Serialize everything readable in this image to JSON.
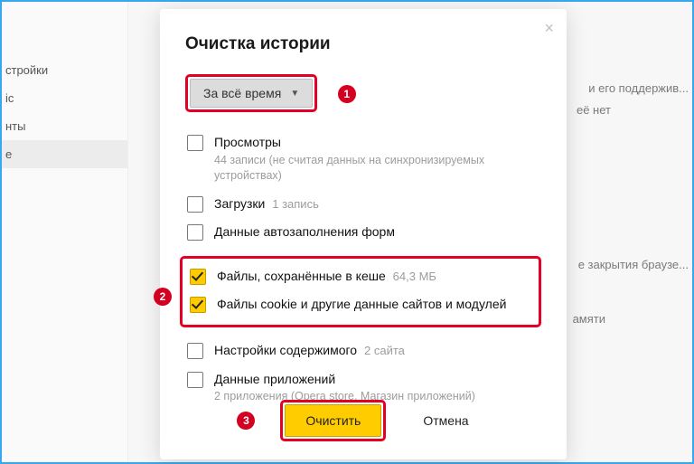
{
  "dialog": {
    "title": "Очистка истории",
    "time_range": {
      "selected": "За всё время"
    },
    "items": {
      "views": {
        "label": "Просмотры",
        "sub": "44 записи (не считая данных на синхронизируемых устройствах)"
      },
      "downloads": {
        "label": "Загрузки",
        "inline": "1 запись"
      },
      "autofill": {
        "label": "Данные автозаполнения форм"
      },
      "cache": {
        "label": "Файлы, сохранённые в кеше",
        "inline": "64,3 МБ"
      },
      "cookies": {
        "label": "Файлы cookie и другие данные сайтов и модулей"
      },
      "content": {
        "label": "Настройки содержимого",
        "inline": "2 сайта"
      },
      "appdata": {
        "label": "Данные приложений",
        "sub": "2 приложения (Opera store, Магазин приложений)"
      }
    },
    "buttons": {
      "clear": "Очистить",
      "cancel": "Отмена"
    }
  },
  "annotations": {
    "one": "1",
    "two": "2",
    "three": "3"
  },
  "bg": {
    "sidebar": {
      "i1": "стройки",
      "i2": "іс",
      "i3": "нты",
      "i4": "е"
    },
    "t1": "и его поддержив...",
    "t2": "её нет",
    "t3": "е закрытия браузе...",
    "t4": "амяти"
  }
}
